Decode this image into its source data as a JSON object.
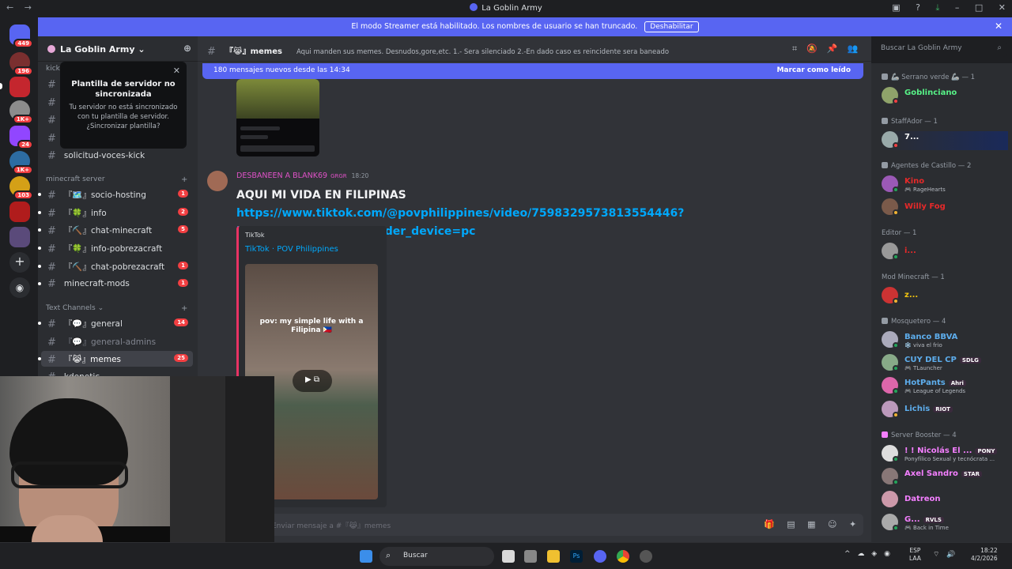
{
  "window": {
    "title": "La Goblin Army",
    "back": "←",
    "forward": "→"
  },
  "banner": {
    "text": "El modo Streamer está habilitado. Los nombres de usuario se han truncado.",
    "button": "Deshabilitar"
  },
  "guilds": [
    {
      "badge": "449"
    },
    {
      "badge": "196"
    },
    {
      "badge": ""
    },
    {
      "badge": "1K+"
    },
    {
      "badge": "24"
    },
    {
      "badge": "1K+"
    },
    {
      "badge": "103"
    },
    {
      "badge": ""
    },
    {
      "badge": ""
    }
  ],
  "server": {
    "name": "La Goblin Army"
  },
  "popup": {
    "title": "Plantilla de servidor no sincronizada",
    "desc": "Tu servidor no está sincronizado con tu plantilla de servidor. ¿Sincronizar plantilla?"
  },
  "sidebar": {
    "cat0": "kick",
    "ch_top": "solicitud-voces-kick",
    "cat1": "minecraft server",
    "mc": [
      {
        "name": "『🗺️』socio-hosting",
        "count": "1"
      },
      {
        "name": "『🍀』info",
        "count": "2"
      },
      {
        "name": "『⛏️』chat-minecraft",
        "count": "5"
      },
      {
        "name": "『🍀』info-pobrezacraft",
        "count": ""
      },
      {
        "name": "『⛏️』chat-pobrezacraft",
        "count": "1"
      },
      {
        "name": "minecraft-mods",
        "count": "1"
      }
    ],
    "cat2": "Text Channels",
    "text": [
      {
        "name": "『💬』general",
        "count": "14"
      },
      {
        "name": "『💬』general-admins",
        "count": ""
      },
      {
        "name": "『😹』memes",
        "count": "25"
      },
      {
        "name": "kdenetic",
        "count": ""
      }
    ]
  },
  "channel": {
    "name": "『😹』memes",
    "topic": "Aqui manden sus memes. Desnudos,gore,etc. 1.- Sera silenciado 2.-En dado caso es reincidente sera baneado"
  },
  "search": {
    "placeholder": "Buscar La Goblin Army"
  },
  "newbar": {
    "text": "180 mensajes nuevos desde las 14:34",
    "mark": "Marcar como leído"
  },
  "message": {
    "author": "DESBANEEN A BLANK69",
    "tag": "GRGR",
    "time": "18:20",
    "text": "AQUI MI VIDA EN FILIPINAS ",
    "link": "https://www.tiktok.com/@povphilippines/video/7598329573813554446?is_from_webapp=1&sender_device=pc"
  },
  "embed": {
    "provider": "TikTok",
    "title": "TikTok · POV Philippines",
    "caption": "pov: my simple life with a Filipina 🇵🇭"
  },
  "input": {
    "placeholder": "Enviar mensaje a #『😹』memes"
  },
  "members": {
    "groups": [
      {
        "title": "🦾 Serrano verde 🦾 — 1"
      },
      {
        "title": "StaffAdor — 1"
      },
      {
        "title": "Agentes de Castillo — 2"
      },
      {
        "title": "Editor — 1"
      },
      {
        "title": "Mod Minecraft — 1"
      },
      {
        "title": "Mosquetero — 4"
      },
      {
        "title": "Server Booster — 4"
      }
    ],
    "list": [
      {
        "name": "Goblinciano",
        "sub": "",
        "badge": "",
        "color": "#57f287"
      },
      {
        "name": "7...",
        "sub": "",
        "badge": "",
        "color": "#ffffff"
      },
      {
        "name": "Kino",
        "sub": "🎮 RageHearts",
        "badge": "",
        "color": "#e62929"
      },
      {
        "name": "Willy Fog",
        "sub": "",
        "badge": "",
        "color": "#e62929"
      },
      {
        "name": "i...",
        "sub": "",
        "badge": "",
        "color": "#e62929"
      },
      {
        "name": "z...",
        "sub": "",
        "badge": "",
        "color": "#f1c40f"
      },
      {
        "name": "Banco BBVA",
        "sub": "❄️ viva el frio",
        "badge": "",
        "color": "#5dadec"
      },
      {
        "name": "CUY DEL CP",
        "sub": "🎮 TLauncher",
        "badge": "SDLG",
        "color": "#5dadec"
      },
      {
        "name": "HotPants",
        "sub": "🎮 League of Legends",
        "badge": "Ahri",
        "color": "#5dadec"
      },
      {
        "name": "Lichis",
        "sub": "",
        "badge": "RIOT",
        "color": "#5dadec"
      },
      {
        "name": "! ! Nicolás El ...",
        "sub": "Ponyfílico Sexual y tecnócrata ...",
        "badge": "PONY",
        "color": "#f47fff"
      },
      {
        "name": "Axel Sandro",
        "sub": "",
        "badge": "STAR",
        "color": "#f47fff"
      },
      {
        "name": "Datreon",
        "sub": "",
        "badge": "",
        "color": "#f47fff"
      },
      {
        "name": "G...",
        "sub": "🎮 Back in Time",
        "badge": "RVLS",
        "color": "#f47fff"
      }
    ]
  },
  "taskbar": {
    "search": "Buscar",
    "lang1": "ESP",
    "lang2": "LAA",
    "time": "18:22",
    "date": "4/2/2026"
  }
}
